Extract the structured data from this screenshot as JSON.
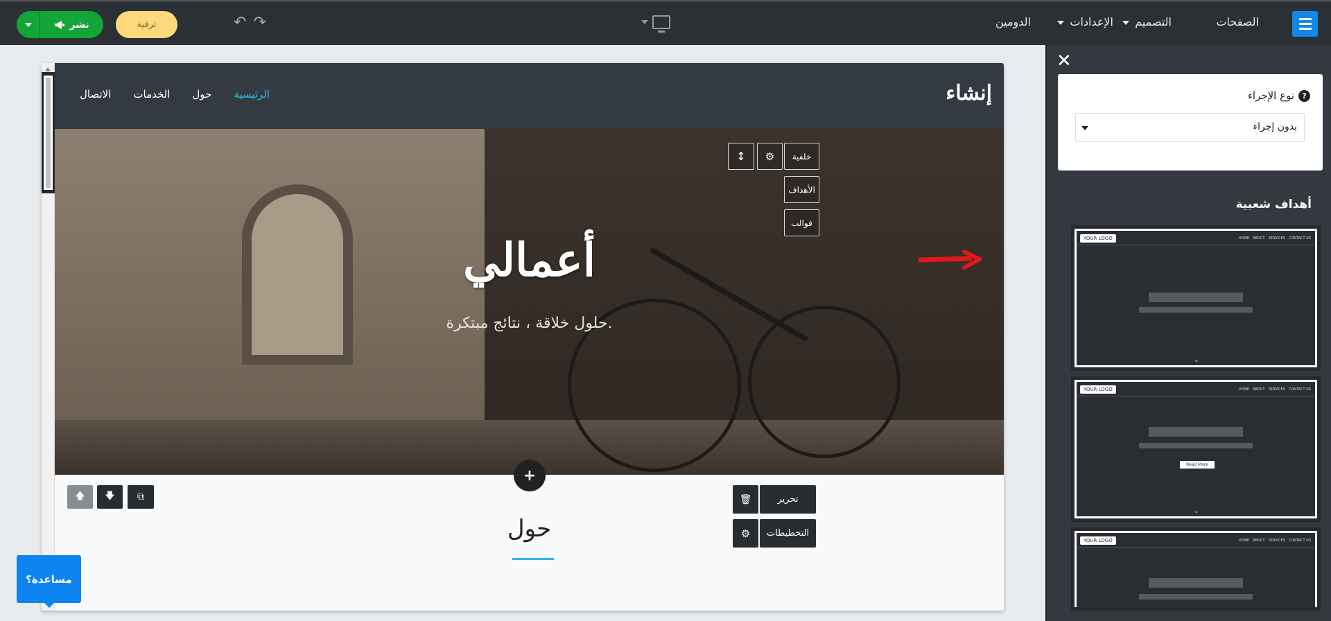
{
  "topbar": {
    "nav": {
      "pages": "الصفحات",
      "design": "التصميم",
      "settings": "الإعدادات",
      "domain": "الدومين"
    },
    "upgrade": "ترقية",
    "publish": "نشر",
    "undo_icon": "↶",
    "redo_icon": "↷",
    "brand_color": "#1387e8",
    "publish_color": "#13a538"
  },
  "site": {
    "logo": "إنشاء",
    "nav": [
      "الرئيسية",
      "حول",
      "الخدمات",
      "الاتصال"
    ],
    "hero_title": "أعمالي",
    "hero_subtitle": "حلول خلاقة ، نتائج مبتكرة.",
    "section_buttons": {
      "background": "خلفية",
      "targets": "الأهداف",
      "templates": "قوالب",
      "settings_icon": "⚙",
      "resize_icon": "↕"
    },
    "add_icon": "+",
    "about_title": "حول",
    "about_buttons": {
      "edit": "تحرير",
      "layouts": "التخطيطات",
      "delete_icon": "🗑",
      "settings_icon": "⚙",
      "up_icon": "🡅",
      "down_icon": "🡇",
      "copy_icon": "⧉"
    },
    "accent_color": "#33b5e5"
  },
  "help": {
    "label": "مساعدة؟"
  },
  "panel": {
    "close_icon": "✕",
    "action_type_label": "نوع الإجراء",
    "help_icon": "?",
    "action_value": "بدون إجراء",
    "popular_title": "أهداف شعبية",
    "thumb": {
      "logo": "YOUR LOGO",
      "nav": [
        "HOME",
        "ABOUT",
        "SERVICES",
        "CONTACT US"
      ],
      "read_more": "Read More",
      "chevron": "⌄"
    }
  }
}
